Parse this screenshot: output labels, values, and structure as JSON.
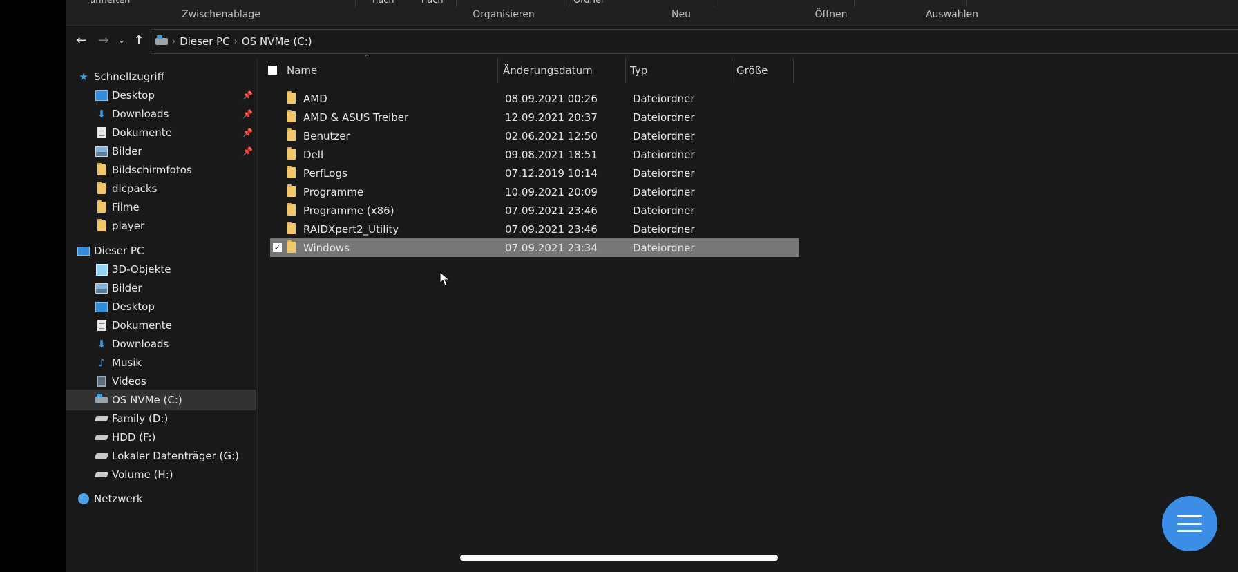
{
  "ribbon": {
    "top_texts": [
      "unheften",
      "nach",
      "nach",
      "Ordner"
    ],
    "groups": [
      "Zwischenablage",
      "Organisieren",
      "Neu",
      "Öffnen",
      "Auswählen"
    ]
  },
  "address": {
    "crumbs": [
      "Dieser PC",
      "OS NVMe (C:)"
    ]
  },
  "sidebar": {
    "quick_access": "Schnellzugriff",
    "quick_items": [
      {
        "label": "Desktop",
        "icon": "desktop-icon",
        "pinned": true
      },
      {
        "label": "Downloads",
        "icon": "downloads-icon",
        "pinned": true
      },
      {
        "label": "Dokumente",
        "icon": "documents-icon",
        "pinned": true
      },
      {
        "label": "Bilder",
        "icon": "pictures-icon",
        "pinned": true
      },
      {
        "label": "Bildschirmfotos",
        "icon": "folder-icon",
        "pinned": false
      },
      {
        "label": "dlcpacks",
        "icon": "folder-icon",
        "pinned": false
      },
      {
        "label": "Filme",
        "icon": "folder-icon",
        "pinned": false
      },
      {
        "label": "player",
        "icon": "folder-icon",
        "pinned": false
      }
    ],
    "this_pc": "Dieser PC",
    "pc_items": [
      {
        "label": "3D-Objekte",
        "icon": "3d-objects-icon"
      },
      {
        "label": "Bilder",
        "icon": "pictures-icon"
      },
      {
        "label": "Desktop",
        "icon": "desktop-icon"
      },
      {
        "label": "Dokumente",
        "icon": "documents-icon"
      },
      {
        "label": "Downloads",
        "icon": "downloads-icon"
      },
      {
        "label": "Musik",
        "icon": "music-icon"
      },
      {
        "label": "Videos",
        "icon": "videos-icon"
      },
      {
        "label": "OS NVMe (C:)",
        "icon": "system-drive-icon",
        "selected": true
      },
      {
        "label": "Family (D:)",
        "icon": "drive-icon"
      },
      {
        "label": "HDD (F:)",
        "icon": "drive-icon"
      },
      {
        "label": "Lokaler Datenträger (G:)",
        "icon": "drive-icon"
      },
      {
        "label": "Volume (H:)",
        "icon": "drive-icon"
      }
    ],
    "network": "Netzwerk"
  },
  "columns": {
    "name": "Name",
    "date": "Änderungsdatum",
    "type": "Typ",
    "size": "Größe"
  },
  "files": [
    {
      "name": "AMD",
      "date": "08.09.2021 00:26",
      "type": "Dateiordner"
    },
    {
      "name": "AMD & ASUS Treiber",
      "date": "12.09.2021 20:37",
      "type": "Dateiordner"
    },
    {
      "name": "Benutzer",
      "date": "02.06.2021 12:50",
      "type": "Dateiordner"
    },
    {
      "name": "Dell",
      "date": "09.08.2021 18:51",
      "type": "Dateiordner"
    },
    {
      "name": "PerfLogs",
      "date": "07.12.2019 10:14",
      "type": "Dateiordner"
    },
    {
      "name": "Programme",
      "date": "10.09.2021 20:09",
      "type": "Dateiordner"
    },
    {
      "name": "Programme (x86)",
      "date": "07.09.2021 23:46",
      "type": "Dateiordner"
    },
    {
      "name": "RAIDXpert2_Utility",
      "date": "07.09.2021 23:46",
      "type": "Dateiordner"
    },
    {
      "name": "Windows",
      "date": "07.09.2021 23:34",
      "type": "Dateiordner",
      "selected": true
    }
  ],
  "colors": {
    "background": "#191919",
    "selection": "#777777",
    "folder": "#f3c763",
    "accent": "#3b8ee8"
  }
}
